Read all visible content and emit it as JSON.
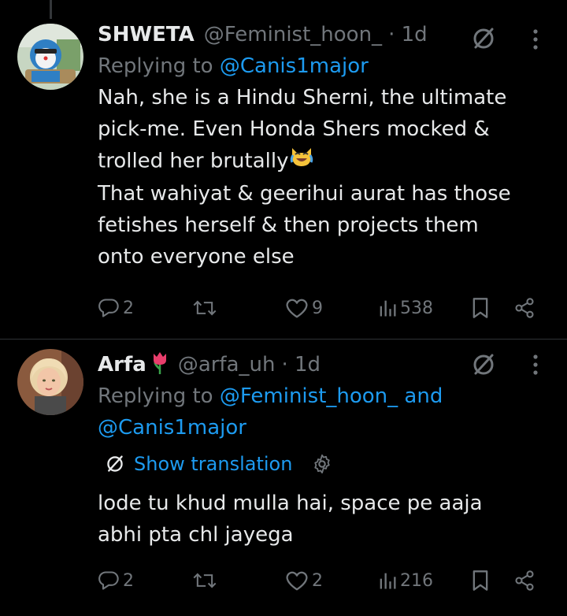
{
  "posts": [
    {
      "name": "SHWETA",
      "handle": "@Feminist_hoon_",
      "time": "· 1d",
      "reply_prefix": "Replying to",
      "reply_to_1": "@Canis1major",
      "reply_to_conj": "",
      "reply_to_2": "",
      "text": "Nah, she is  a Hindu Sherni, the ultimate\npick-me. Even Honda Shers mocked &\ntrolled her brutally",
      "emoji": "laughing-crying-cat-icon",
      "text2": "\nThat wahiyat & geerihui aurat has those\nfetishes herself & then projects them\nonto everyone else",
      "replies": "2",
      "reposts": "",
      "likes": "9",
      "views": "538"
    },
    {
      "name": "Arfa",
      "name_emoji": "tulip-icon",
      "handle": "@arfa_uh",
      "time": "· 1d",
      "reply_prefix": "Replying to",
      "reply_to_1": "@Feminist_hoon_",
      "reply_to_conj": "and",
      "reply_to_2": "@Canis1major",
      "translate_label": "Show translation",
      "text": "lode tu khud mulla hai, space pe aaja\nabhi pta chl jayega",
      "replies": "2",
      "reposts": "",
      "likes": "2",
      "views": "216"
    }
  ],
  "colors": {
    "background": "#000000",
    "text": "#e7e9ea",
    "secondary": "#71767b",
    "link": "#1d9bf0",
    "divider": "#2f3336"
  }
}
